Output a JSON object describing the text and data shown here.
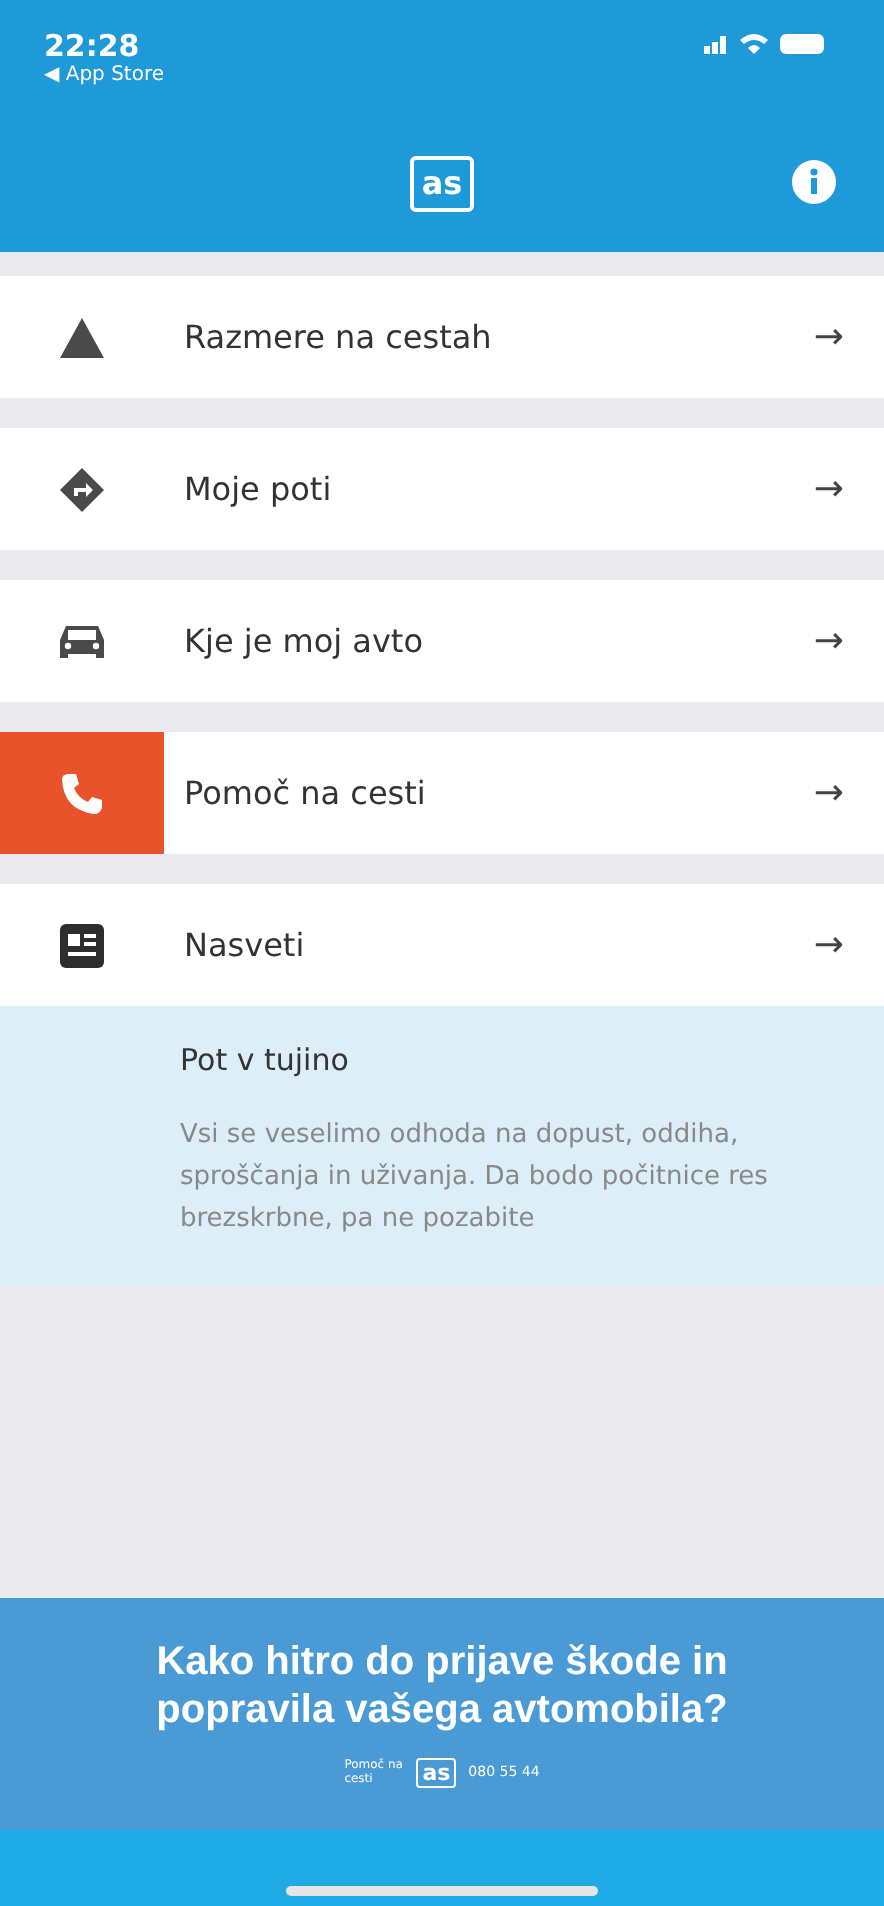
{
  "status_bar": {
    "time": "22:28",
    "back_label": "◀ App Store"
  },
  "nav_bar": {
    "logo": "as"
  },
  "menu": [
    {
      "label": "Razmere na cestah",
      "kind": "warning",
      "highlighted": false,
      "arrow": "→"
    },
    {
      "label": "Moje poti",
      "kind": "directions",
      "highlighted": false,
      "arrow": "→"
    },
    {
      "label": "Kje je moj avto",
      "kind": "car",
      "highlighted": false,
      "arrow": "→"
    },
    {
      "label": "Pomoč na cesti",
      "kind": "phone",
      "highlighted": true,
      "arrow": "→"
    },
    {
      "label": "Nasveti",
      "kind": "news",
      "highlighted": false,
      "arrow": "→"
    }
  ],
  "tip": {
    "title": "Pot v tujino",
    "text": "Vsi se veselimo odhoda na dopust, oddiha, sproščanja in uživanja. Da bodo počitnice res brezskrbne, pa ne pozabite"
  },
  "banner": {
    "headline": "Kako hitro do prijave škode in popravila vašega avtomobila?",
    "tagline": "Pomoč na cesti",
    "logo": "as",
    "phone": "080 55 44"
  }
}
